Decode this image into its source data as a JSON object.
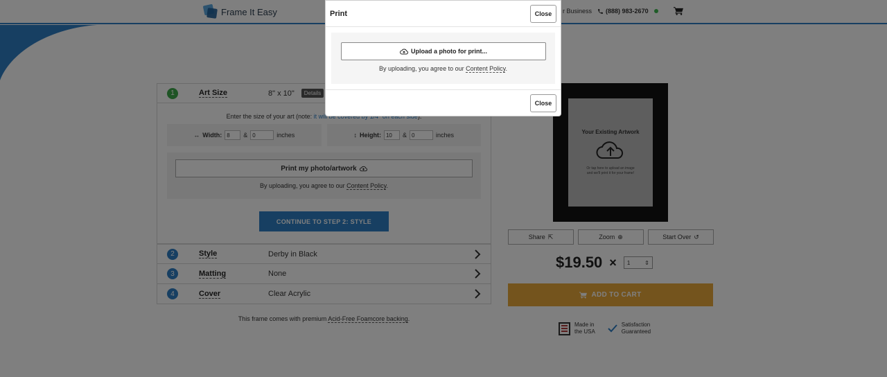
{
  "header": {
    "brand": "Frame It Easy",
    "business_link": "r Business",
    "phone": "(888) 983-2670",
    "online_color": "#3fb950"
  },
  "steps": [
    {
      "num": "1",
      "label": "Art Size",
      "value": "8\" x 10\"",
      "badge": "Details"
    },
    {
      "num": "2",
      "label": "Style",
      "value": "Derby in Black"
    },
    {
      "num": "3",
      "label": "Matting",
      "value": "None"
    },
    {
      "num": "4",
      "label": "Cover",
      "value": "Clear Acrylic"
    }
  ],
  "art_size": {
    "note_prefix": "Enter the size of your art (note: ",
    "note_link": "it will be covered by 1/4\" on each side",
    "note_suffix": ").",
    "width_label": "Width:",
    "width_value": "8",
    "width_fraction": "0",
    "height_label": "Height:",
    "height_value": "10",
    "height_fraction": "0",
    "amp": "&",
    "unit": "inches",
    "print_button": "Print my photo/artwork",
    "agree_prefix": "By uploading, you agree to our ",
    "agree_link": "Content Policy",
    "agree_suffix": ".",
    "continue_button": "CONTINUE TO STEP 2: STYLE"
  },
  "backing_note": {
    "prefix": "This frame comes with premium ",
    "link": "Acid-Free Foamcore backing",
    "suffix": "."
  },
  "preview": {
    "title": "Your Existing Artwork",
    "sub_line1": "Or tap here to upload an image",
    "sub_line2": "and we'll print it for your frame!"
  },
  "tools": {
    "share": "Share",
    "zoom": "Zoom",
    "start_over": "Start Over"
  },
  "purchase": {
    "price": "$19.50",
    "times": "×",
    "quantity": "1",
    "add_to_cart": "ADD TO CART",
    "accent_color": "#e9a83a"
  },
  "badges": {
    "usa_line1": "Made in",
    "usa_line2": "the USA",
    "sat_line1": "Satisfaction",
    "sat_line2": "Guaranteed"
  },
  "modal": {
    "title": "Print",
    "close_top": "Close",
    "upload_button": "Upload a photo for print...",
    "agree_prefix": "By uploading, you agree to our ",
    "agree_link": "Content Policy",
    "agree_suffix": ".",
    "close_bottom": "Close"
  }
}
